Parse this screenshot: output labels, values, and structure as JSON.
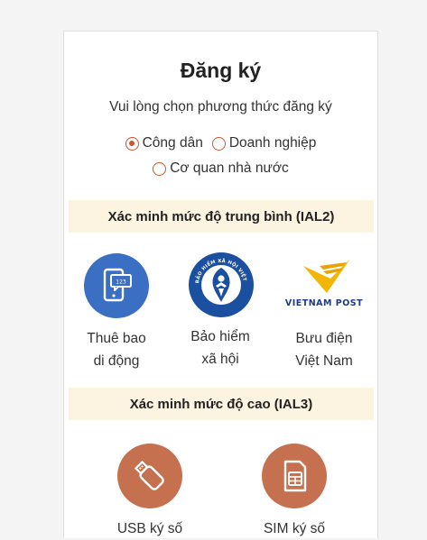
{
  "title": "Đăng ký",
  "subtitle": "Vui lòng chọn phương thức đăng ký",
  "radios": [
    {
      "label": "Công dân",
      "checked": true
    },
    {
      "label": "Doanh nghiệp",
      "checked": false
    },
    {
      "label": "Cơ quan nhà nước",
      "checked": false
    }
  ],
  "sections": {
    "ial2": {
      "heading": "Xác minh mức độ trung bình (IAL2)",
      "options": [
        {
          "label": "Thuê bao\ndi động",
          "icon": "phone-sms-icon"
        },
        {
          "label": "Bảo hiểm\nxã hội",
          "icon": "social-insurance-logo",
          "logo_text": "BẢO HIỂM XÃ HỘI VIỆT NAM"
        },
        {
          "label": "Bưu điện\nViệt Nam",
          "icon": "vietnam-post-logo",
          "logo_text": "VIETNAM POST"
        }
      ]
    },
    "ial3": {
      "heading": "Xác minh mức độ cao (IAL3)",
      "options": [
        {
          "label": "USB ký số",
          "icon": "usb-token-icon"
        },
        {
          "label": "SIM ký số",
          "icon": "sim-card-icon"
        }
      ]
    }
  },
  "colors": {
    "accent": "#c8572c",
    "section_bg": "#fdf3e1",
    "blue_icon": "#3a6fc4",
    "brown_icon": "#c5714f",
    "bhxh_blue": "#1b4fa0",
    "vnpost_yellow": "#f2b705"
  }
}
